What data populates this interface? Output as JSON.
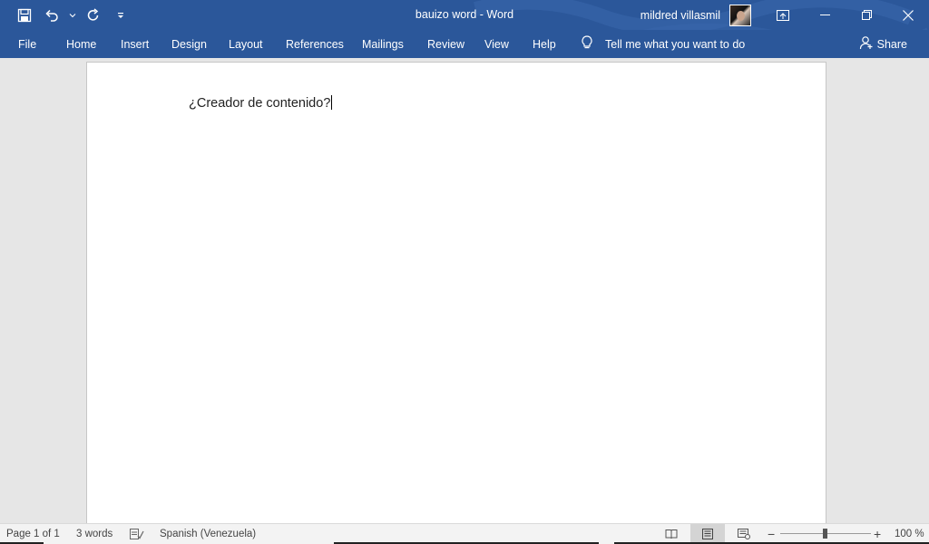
{
  "window": {
    "title": "bauizo word  -  Word",
    "user_name": "mildred villasmil"
  },
  "quick_access": {
    "icons": [
      "save-icon",
      "undo-icon",
      "undo-dropdown-icon",
      "redo-icon",
      "customize-qat-icon"
    ]
  },
  "window_controls": {
    "icons": [
      "ribbon-display-options-icon",
      "minimize-icon",
      "restore-icon",
      "close-icon"
    ]
  },
  "ribbon": {
    "tabs": [
      "File",
      "Home",
      "Insert",
      "Design",
      "Layout",
      "References",
      "Mailings",
      "Review",
      "View",
      "Help"
    ],
    "tell_me": "Tell me what you want to do",
    "share": "Share"
  },
  "document": {
    "text": "¿Creador de contenido?"
  },
  "status": {
    "page": "Page 1 of 1",
    "words": "3 words",
    "language": "Spanish (Venezuela)",
    "zoom": "100 %",
    "zoom_percent": 100,
    "active_view": "print-layout"
  },
  "colors": {
    "ribbon_blue": "#2b579a",
    "canvas_gray": "#e6e6e6",
    "status_bar": "#f3f3f3"
  }
}
